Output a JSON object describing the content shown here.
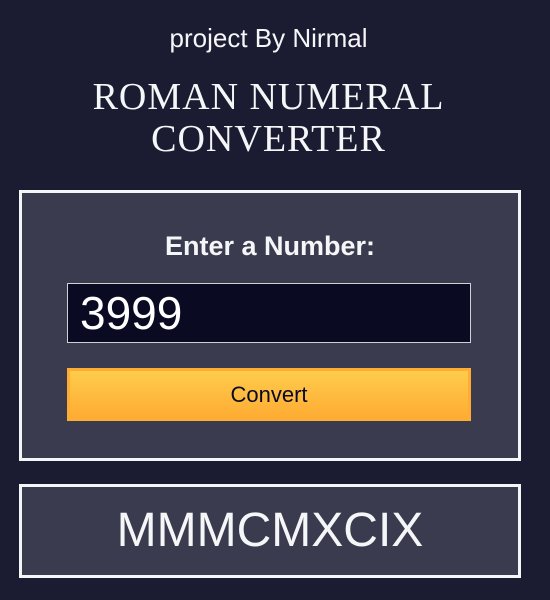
{
  "header": {
    "credit": "project By Nirmal",
    "title_line1": "ROMAN NUMERAL",
    "title_line2": "CONVERTER"
  },
  "form": {
    "label": "Enter a Number:",
    "number_value": "3999",
    "convert_label": "Convert"
  },
  "output": {
    "result": "MMMCMXCIX"
  },
  "colors": {
    "background": "#1b1b32",
    "panel": "#3b3b4f",
    "input_background": "#0a0a23",
    "button_gradient_top": "#fecc4c",
    "button_gradient_bottom": "#ffac33",
    "text": "#f5f6f7"
  }
}
